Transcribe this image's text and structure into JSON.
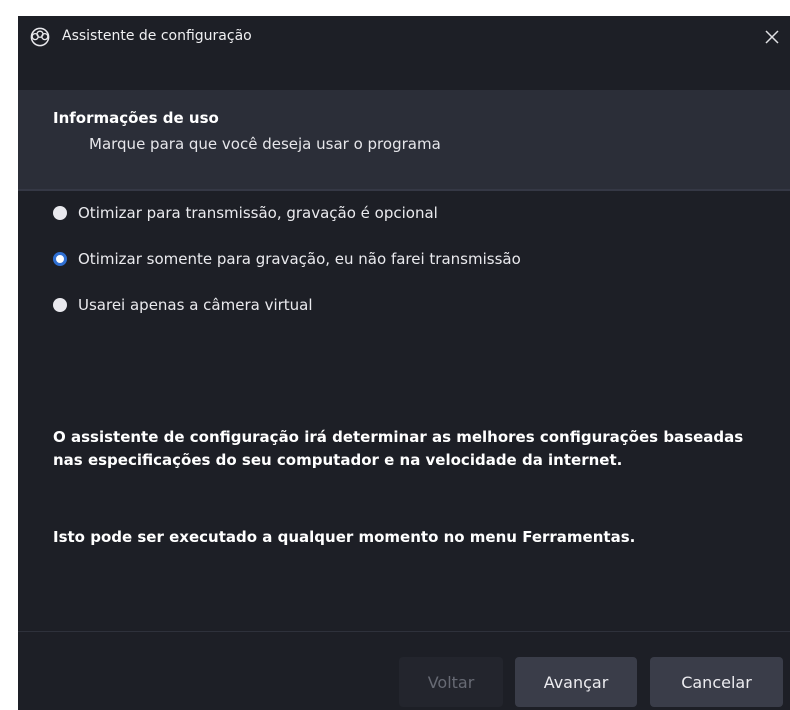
{
  "window": {
    "title": "Assistente de configuração",
    "close_icon": "close-icon",
    "app_icon": "obs-logo-icon"
  },
  "header": {
    "title": "Informações de uso",
    "subtitle": "Marque para que você deseja usar o programa"
  },
  "options": [
    {
      "label": "Otimizar para transmissão, gravação é opcional",
      "checked": false
    },
    {
      "label": "Otimizar somente para gravação, eu não farei transmissão",
      "checked": true
    },
    {
      "label": "Usarei apenas a câmera virtual",
      "checked": false
    }
  ],
  "info": {
    "paragraph_1": "O assistente de configuração irá determinar as melhores configurações baseadas nas especificações do seu computador e na velocidade da internet.",
    "paragraph_2": "Isto pode ser executado a qualquer momento no menu Ferramentas."
  },
  "buttons": {
    "back": "Voltar",
    "next": "Avançar",
    "cancel": "Cancelar"
  },
  "colors": {
    "background": "#1d1f26",
    "header_band": "#2b2e38",
    "accent": "#2f6fd2",
    "button": "#3a3d49"
  }
}
